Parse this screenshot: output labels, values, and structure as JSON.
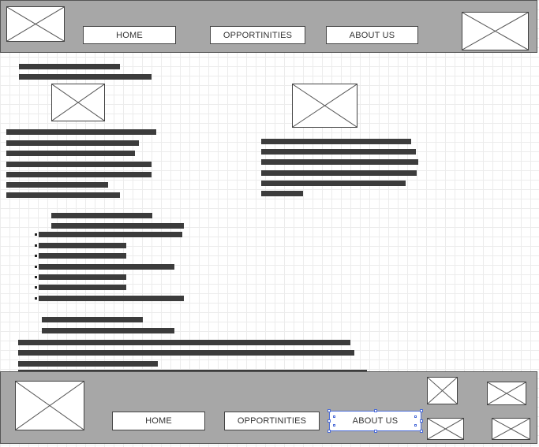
{
  "header": {
    "nav": [
      {
        "label": "HOME"
      },
      {
        "label": "OPPORTINITIES"
      },
      {
        "label": "ABOUT US"
      }
    ]
  },
  "footer": {
    "nav": [
      {
        "label": "HOME"
      },
      {
        "label": "OPPORTINITIES"
      },
      {
        "label": "ABOUT US",
        "selected": true
      }
    ]
  },
  "colors": {
    "frame_gray": "#a7a7a7",
    "text_placeholder": "#3c3c3c",
    "selection_blue": "#4a6bd8"
  }
}
